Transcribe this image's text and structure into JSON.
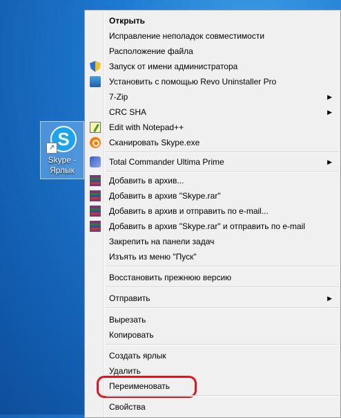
{
  "desktop": {
    "shortcut_label": "Skype - Ярлык",
    "logo_letter": "S"
  },
  "menu": {
    "items": [
      {
        "label": "Открыть",
        "bold": true
      },
      {
        "label": "Исправление неполадок совместимости"
      },
      {
        "label": "Расположение файла"
      },
      {
        "label": "Запуск от имени администратора",
        "icon": "uac-shield-icon"
      },
      {
        "label": "Установить с помощью Revo Uninstaller Pro",
        "icon": "revo-uninstaller-icon"
      },
      {
        "label": "7-Zip",
        "submenu": true
      },
      {
        "label": "CRC SHA",
        "submenu": true
      },
      {
        "label": "Edit with Notepad++",
        "icon": "notepad-plus-plus-icon"
      },
      {
        "label": "Сканировать Skype.exe",
        "icon": "avast-icon"
      },
      {
        "label": "Total Commander Ultima Prime",
        "icon": "total-commander-icon",
        "submenu": true
      },
      {
        "label": "Добавить в архив...",
        "icon": "winrar-icon"
      },
      {
        "label": "Добавить в архив \"Skype.rar\"",
        "icon": "winrar-icon"
      },
      {
        "label": "Добавить в архив и отправить по e-mail...",
        "icon": "winrar-icon"
      },
      {
        "label": "Добавить в архив \"Skype.rar\" и отправить по e-mail",
        "icon": "winrar-icon"
      },
      {
        "label": "Закрепить на панели задач"
      },
      {
        "label": "Изъять из меню \"Пуск\""
      },
      {
        "label": "Восстановить прежнюю версию"
      },
      {
        "label": "Отправить",
        "submenu": true
      },
      {
        "label": "Вырезать"
      },
      {
        "label": "Копировать"
      },
      {
        "label": "Создать ярлык"
      },
      {
        "label": "Удалить"
      },
      {
        "label": "Переименовать",
        "highlighted": true
      },
      {
        "label": "Свойства"
      }
    ],
    "submenu_arrow": "▶",
    "highlight_color": "#e0141e"
  }
}
